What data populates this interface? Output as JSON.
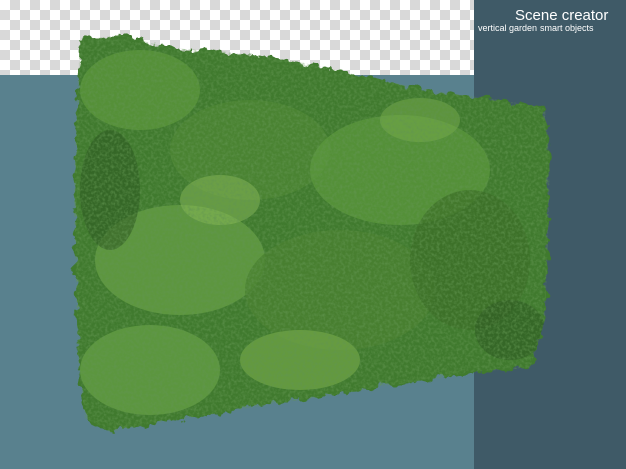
{
  "branding": {
    "title": "Scene creator",
    "subtitle_left": "vertical garden",
    "subtitle_right": "smart objects"
  },
  "image": {
    "subject": "vertical-garden-plant-wall",
    "background": "transparency-checkerboard"
  },
  "colors": {
    "panel_main": "#59818e",
    "panel_side": "#3f5a67",
    "foliage_dark": "#2f5a23",
    "foliage_mid": "#4f8a34",
    "foliage_light": "#7fb24f"
  }
}
